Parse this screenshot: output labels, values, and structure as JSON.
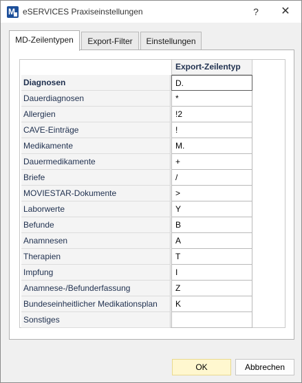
{
  "window": {
    "title": "eSERVICES Praxiseinstellungen",
    "help_label": "?",
    "close_label": "✕"
  },
  "tabs": [
    {
      "label": "MD-Zeilentypen",
      "active": true
    },
    {
      "label": "Export-Filter",
      "active": false
    },
    {
      "label": "Einstellungen",
      "active": false
    }
  ],
  "grid": {
    "column_header": "Export-Zeilentyp",
    "rows": [
      {
        "label": "Diagnosen",
        "value": "D."
      },
      {
        "label": "Dauerdiagnosen",
        "value": "*"
      },
      {
        "label": "Allergien",
        "value": "!2"
      },
      {
        "label": "CAVE-Einträge",
        "value": "!"
      },
      {
        "label": "Medikamente",
        "value": "M."
      },
      {
        "label": "Dauermedikamente",
        "value": "+"
      },
      {
        "label": "Briefe",
        "value": "/"
      },
      {
        "label": "MOVIESTAR-Dokumente",
        "value": ">"
      },
      {
        "label": "Laborwerte",
        "value": "Y"
      },
      {
        "label": "Befunde",
        "value": "B"
      },
      {
        "label": "Anamnesen",
        "value": "A"
      },
      {
        "label": "Therapien",
        "value": "T"
      },
      {
        "label": "Impfung",
        "value": "I"
      },
      {
        "label": "Anamnese-/Befunderfassung",
        "value": "Z"
      },
      {
        "label": "Bundeseinheitlicher Medikationsplan",
        "value": "K"
      },
      {
        "label": "Sonstiges",
        "value": ""
      }
    ]
  },
  "footer": {
    "ok_label": "OK",
    "cancel_label": "Abbrechen"
  },
  "colors": {
    "ok_button_bg": "#fff7cf",
    "app_icon": "#1c4f9a"
  }
}
